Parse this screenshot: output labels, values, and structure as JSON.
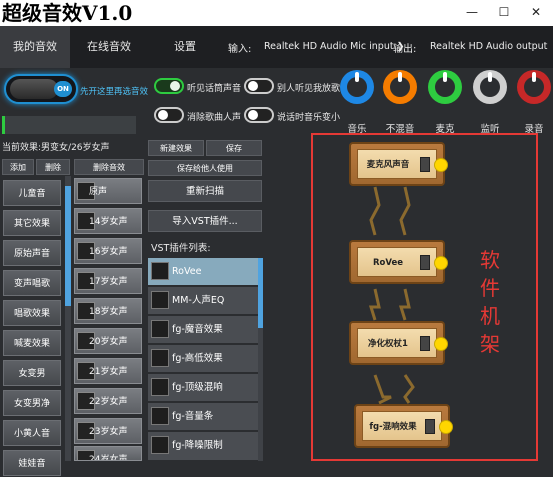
{
  "window": {
    "title": "超级音效V1.0",
    "minimize": "—",
    "maximize": "☐",
    "close": "✕"
  },
  "tabs": [
    {
      "label": "我的音效",
      "active": true
    },
    {
      "label": "在线音效",
      "active": false
    },
    {
      "label": "设置",
      "active": false
    }
  ],
  "io": {
    "input_label": "输入:",
    "input_value": "Realtek HD Audio Mic input",
    "output_label": "输出:",
    "output_value": "Realtek HD Audio output"
  },
  "left": {
    "power_state": "ON",
    "first_select_hint": "先开这里再选音效",
    "current_effect": "当前效果:男变女/26岁女声",
    "buttons": {
      "add": "添加",
      "delete": "删除",
      "delete_effect": "删除音效"
    },
    "categories": [
      "儿童音",
      "其它效果",
      "原始声音",
      "变声唱歌",
      "唱歌效果",
      "喊麦效果",
      "女变男",
      "女变男净",
      "小黄人音",
      "娃娃音"
    ],
    "presets": [
      "原声",
      "14岁女声",
      "16岁女声",
      "17岁女声",
      "18岁女声",
      "20岁女声",
      "21岁女声",
      "22岁女声",
      "23岁女声",
      "24岁女声"
    ]
  },
  "options": [
    {
      "label": "听见话筒声音",
      "on": true
    },
    {
      "label": "别人听见我放歌",
      "on": false
    },
    {
      "label": "消除歌曲人声",
      "on": false
    },
    {
      "label": "说话时音乐变小",
      "on": false
    }
  ],
  "middle": {
    "new_effect": "新建效果",
    "save": "保存",
    "save_for_others": "保存给他人使用",
    "rescan": "重新扫描",
    "import_vst": "导入VST插件...",
    "vst_list_label": "VST插件列表:",
    "vst_plugins": [
      "RoVee",
      "MM-人声EQ",
      "fg-魔音效果",
      "fg-高低效果",
      "fg-顶级混响",
      "fg-音量条",
      "fg-降噪限制"
    ]
  },
  "knobs": [
    {
      "label": "音乐",
      "color": "#1e88e5",
      "icon": "music-knob-icon"
    },
    {
      "label": "不混音",
      "color": "#f57c00",
      "icon": "nomix-knob-icon"
    },
    {
      "label": "麦克",
      "color": "#2ecc40",
      "icon": "mic-knob-icon"
    },
    {
      "label": "监听",
      "color": "#cfcfcf",
      "icon": "monitor-knob-icon"
    },
    {
      "label": "录音",
      "color": "#c62828",
      "icon": "record-knob-icon"
    }
  ],
  "chain": {
    "nodes": [
      "麦克风声音",
      "RoVee",
      "净化权杖1",
      "fg-混响效果"
    ],
    "frame_label": "软件机架",
    "frame_color": "#e53935"
  }
}
